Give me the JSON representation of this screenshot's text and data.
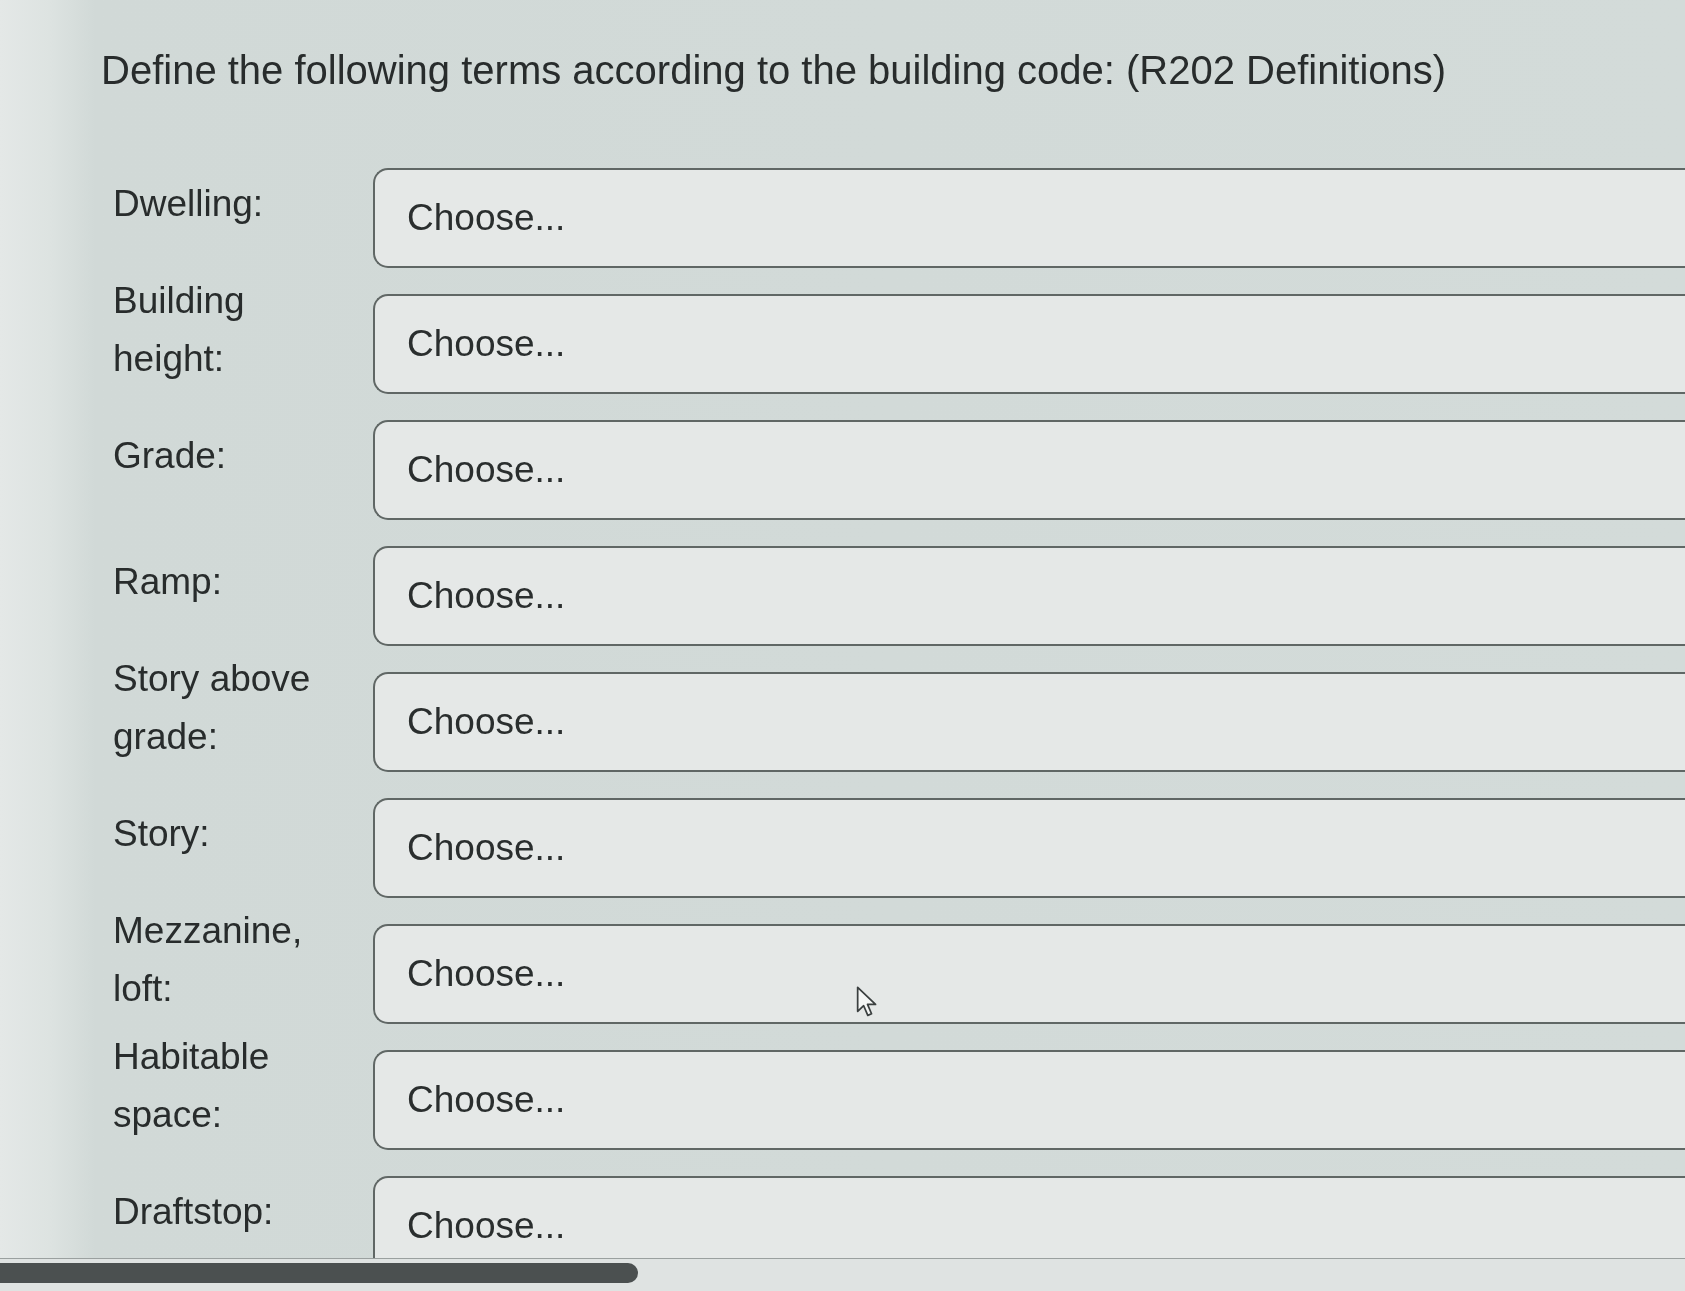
{
  "question": {
    "text": "Define the following terms according to the building code: (R202 Definitions)"
  },
  "rows": [
    {
      "label": "Dwelling:",
      "dropdown": {
        "value": "Choose..."
      }
    },
    {
      "label": "Building height:",
      "dropdown": {
        "value": "Choose..."
      }
    },
    {
      "label": "Grade:",
      "dropdown": {
        "value": "Choose..."
      }
    },
    {
      "label": "Ramp:",
      "dropdown": {
        "value": "Choose..."
      }
    },
    {
      "label": "Story above grade:",
      "dropdown": {
        "value": "Choose..."
      }
    },
    {
      "label": "Story:",
      "dropdown": {
        "value": "Choose..."
      }
    },
    {
      "label": "Mezzanine, loft:",
      "dropdown": {
        "value": "Choose..."
      }
    },
    {
      "label": "Habitable space:",
      "dropdown": {
        "value": "Choose..."
      }
    },
    {
      "label": "Draftstop:",
      "dropdown": {
        "value": "Choose..."
      }
    }
  ]
}
